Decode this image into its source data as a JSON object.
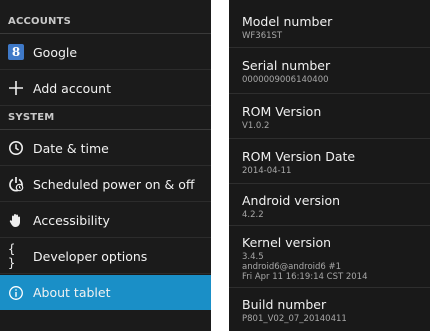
{
  "left": {
    "accounts_header": "ACCOUNTS",
    "system_header": "SYSTEM",
    "items": [
      {
        "label": "Google",
        "icon": "google-icon",
        "icon_text": "8"
      },
      {
        "label": "Add account",
        "icon": "plus-icon"
      },
      {
        "label": "Date & time",
        "icon": "clock-icon"
      },
      {
        "label": "Scheduled power on & off",
        "icon": "power-clock-icon"
      },
      {
        "label": "Accessibility",
        "icon": "hand-icon"
      },
      {
        "label": "Developer options",
        "icon": "braces-icon",
        "icon_text": "{ }"
      },
      {
        "label": "About tablet",
        "icon": "info-icon",
        "selected": true
      }
    ]
  },
  "right": {
    "rows": [
      {
        "title": "Model number",
        "value": "WF361ST"
      },
      {
        "title": "Serial number",
        "value": "0000009006140400"
      },
      {
        "title": "ROM Version",
        "value": "V1.0.2"
      },
      {
        "title": "ROM Version Date",
        "value": "2014-04-11"
      },
      {
        "title": "Android version",
        "value": "4.2.2"
      },
      {
        "title": "Kernel version",
        "value": "3.4.5",
        "value2": "android6@android6 #1",
        "value3": "Fri Apr 11 16:19:14 CST 2014"
      },
      {
        "title": "Build number",
        "value": "P801_V02_07_20140411"
      }
    ]
  },
  "colors": {
    "selected_bg": "#1a8fc7",
    "panel_bg": "#1b1b1b",
    "google_blue": "#3f79c8"
  }
}
